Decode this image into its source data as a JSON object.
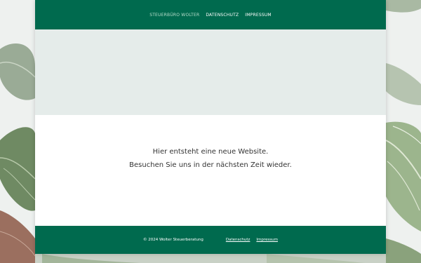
{
  "colors": {
    "brand_green": "#006a4e",
    "active_nav": "#b9ddcc",
    "hero_bg": "#e5ecea",
    "text_dark": "#333333"
  },
  "nav": {
    "items": [
      {
        "label": "STEUERBÜRO WOLTER",
        "active": true
      },
      {
        "label": "DATENSCHUTZ",
        "active": false
      },
      {
        "label": "IMPRESSUM",
        "active": false
      }
    ]
  },
  "main": {
    "line1": "Hier entsteht eine neue Website.",
    "line2": "Besuchen Sie uns in der nächsten Zeit wieder."
  },
  "footer": {
    "copyright": "© 2024 Wolter Steuerberatung",
    "links": [
      {
        "label": "Datenschutz"
      },
      {
        "label": "Impressum"
      }
    ]
  }
}
